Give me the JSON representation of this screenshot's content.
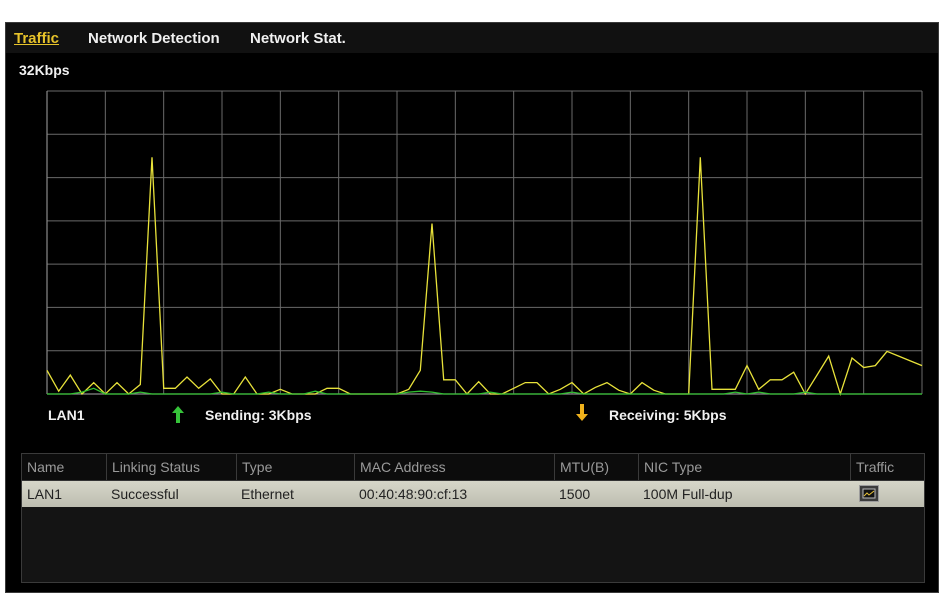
{
  "tabs": [
    {
      "label": "Traffic",
      "active": true
    },
    {
      "label": "Network Detection",
      "active": false
    },
    {
      "label": "Network Stat.",
      "active": false
    }
  ],
  "chart_data": {
    "type": "line",
    "scale_label": "32Kbps",
    "ylim": [
      0,
      32
    ],
    "xlim": [
      0,
      76
    ],
    "grid": true,
    "series": [
      {
        "color": "#e8e23a",
        "values": [
          2.5,
          0.3,
          2.0,
          0,
          1.2,
          0,
          1.2,
          0,
          1.0,
          25.0,
          0.6,
          0.6,
          1.8,
          0.6,
          1.6,
          0,
          0,
          1.8,
          0,
          0,
          0.5,
          0,
          0,
          0,
          0.6,
          0.6,
          0,
          0,
          0,
          0,
          0,
          0.5,
          2.5,
          18.0,
          1.5,
          1.5,
          0,
          1.3,
          0,
          0,
          0.6,
          1.2,
          1.2,
          0,
          0.5,
          1.2,
          0,
          0.7,
          1.2,
          0.4,
          0,
          1.2,
          0.4,
          0,
          0,
          0,
          25.0,
          0.5,
          0.5,
          0.5,
          3.0,
          0.5,
          1.5,
          1.5,
          2.3,
          0,
          2.0,
          4.0,
          0,
          3.8,
          2.8,
          3.0,
          4.5,
          4.0,
          3.5,
          3.0
        ]
      },
      {
        "color": "#30c030",
        "values": [
          0,
          0,
          0,
          0.2,
          0.6,
          0,
          0,
          0,
          0.2,
          0,
          0,
          0,
          0,
          0,
          0,
          0.2,
          0,
          0,
          0,
          0.2,
          0,
          0,
          0,
          0.3,
          0,
          0,
          0,
          0,
          0,
          0,
          0,
          0.2,
          0.3,
          0.2,
          0,
          0,
          0,
          0,
          0.2,
          0,
          0,
          0,
          0,
          0,
          0,
          0.2,
          0,
          0,
          0,
          0,
          0,
          0,
          0,
          0,
          0,
          0,
          0,
          0,
          0,
          0.2,
          0,
          0.2,
          0,
          0,
          0,
          0.2,
          0,
          0,
          0,
          0,
          0,
          0,
          0,
          0,
          0,
          0
        ]
      }
    ],
    "colors": {
      "grid": "#6a6a6a",
      "axis": "#8a8a8a",
      "background": "#000000"
    }
  },
  "legend": {
    "interface": "LAN1",
    "sending": "Sending: 3Kbps",
    "receiving": "Receiving: 5Kbps",
    "sending_icon": "arrow-up-icon",
    "receiving_icon": "arrow-down-icon"
  },
  "table": {
    "headers": [
      "Name",
      "Linking Status",
      "Type",
      "MAC Address",
      "MTU(B)",
      "NIC Type",
      "Traffic"
    ],
    "rows": [
      {
        "name": "LAN1",
        "status": "Successful",
        "type": "Ethernet",
        "mac": "00:40:48:90:cf:13",
        "mtu": "1500",
        "nic": "100M Full-dup",
        "traffic_icon": "traffic-chart-icon"
      }
    ]
  }
}
